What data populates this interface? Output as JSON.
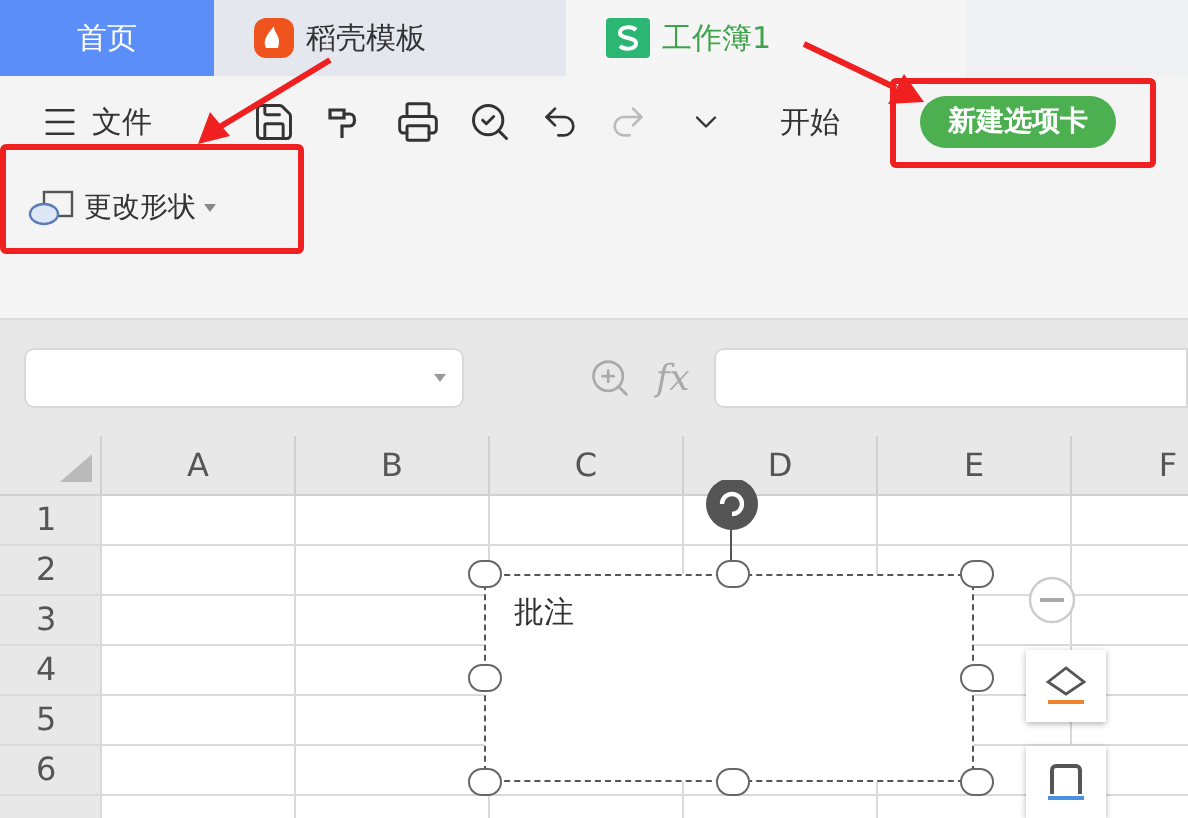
{
  "tabs": [
    {
      "label": "首页",
      "selected": false,
      "kind": "home"
    },
    {
      "label": "稻壳模板",
      "selected": false,
      "kind": "docer"
    },
    {
      "label": "工作簿1",
      "selected": true,
      "kind": "sheet"
    }
  ],
  "toolbar": {
    "menu_label": "文件",
    "start_label": "开始",
    "new_tab_button": "新建选项卡"
  },
  "ribbon": {
    "change_shape": "更改形状"
  },
  "formula_bar": {
    "fx": "fx"
  },
  "columns": [
    "A",
    "B",
    "C",
    "D",
    "E",
    "F"
  ],
  "rows": [
    "1",
    "2",
    "3",
    "4",
    "5",
    "6"
  ],
  "comment": {
    "text": "批注"
  }
}
